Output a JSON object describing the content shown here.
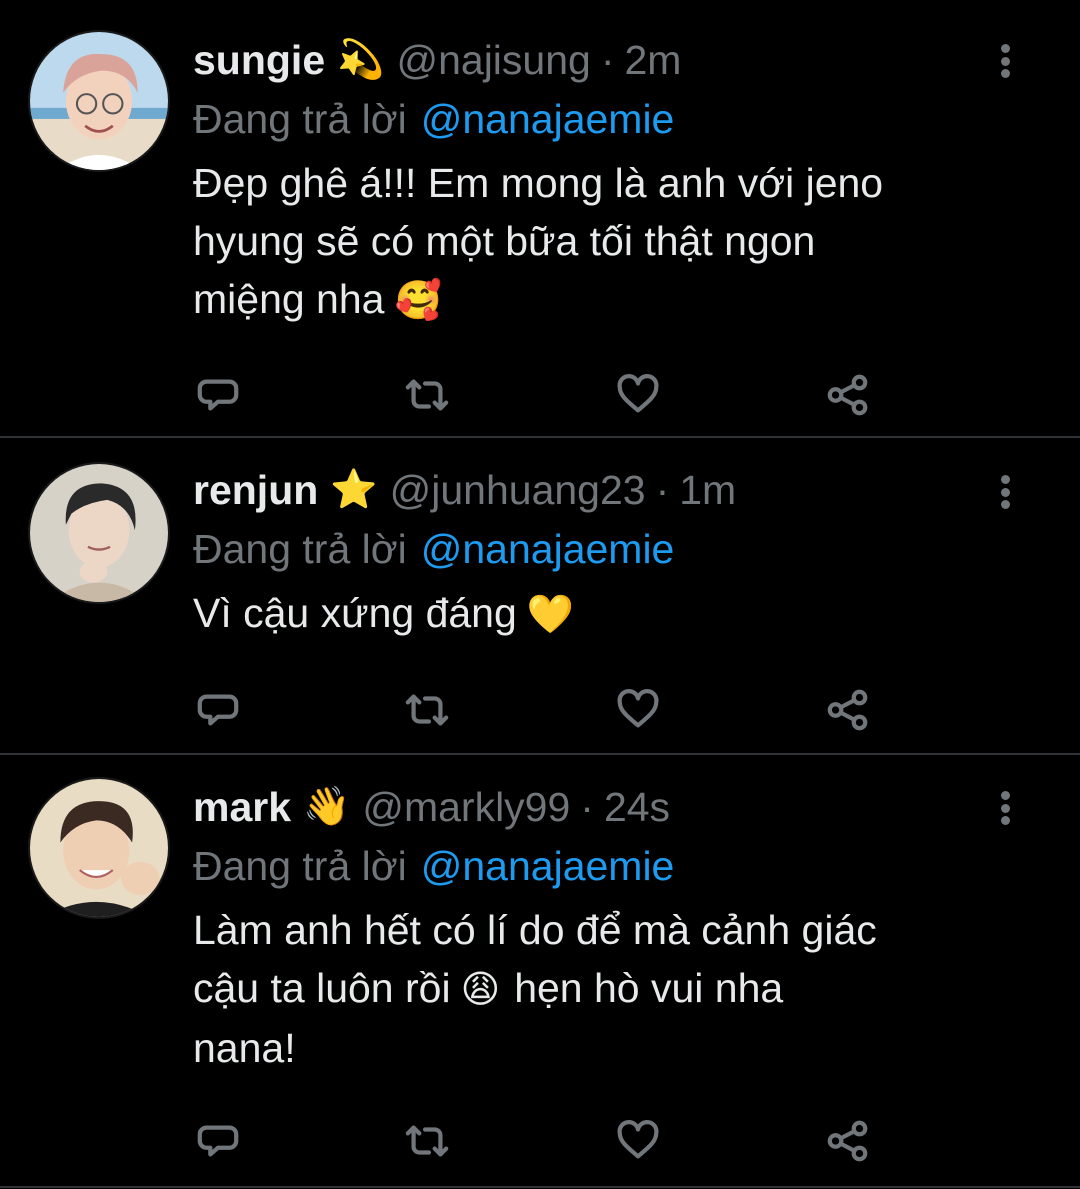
{
  "tweets": [
    {
      "display_name": "sungie",
      "badge_emoji": "💫",
      "handle": "@najisung",
      "separator": "·",
      "time": "2m",
      "reply_prefix": "Đang trả lời",
      "reply_to": "@nanajaemie",
      "body_lines": [
        "Đẹp ghê á!!! Em mong là anh với jeno",
        "hyung sẽ có một bữa tối thật ngon",
        "miệng nha"
      ],
      "body_emoji": "🥰",
      "avatar": "avatar-sungie",
      "icons": {
        "reply": "reply-icon",
        "retweet": "retweet-icon",
        "like": "heart-icon",
        "share": "share-icon",
        "more": "more-vertical-icon"
      }
    },
    {
      "display_name": "renjun",
      "badge_emoji": "⭐",
      "handle": "@junhuang23",
      "separator": "·",
      "time": "1m",
      "reply_prefix": "Đang trả lời",
      "reply_to": "@nanajaemie",
      "body_lines": [
        "Vì cậu xứng đáng"
      ],
      "body_emoji": "💛",
      "avatar": "avatar-renjun",
      "icons": {
        "reply": "reply-icon",
        "retweet": "retweet-icon",
        "like": "heart-icon",
        "share": "share-icon",
        "more": "more-vertical-icon"
      }
    },
    {
      "display_name": "mark",
      "badge_emoji": "👋",
      "handle": "@markly99",
      "separator": "·",
      "time": "24s",
      "reply_prefix": "Đang trả lời",
      "reply_to": "@nanajaemie",
      "body_lines": [
        "Làm anh hết có lí do để mà cảnh giác",
        "cậu ta luôn rồi",
        "hẹn hò vui nha",
        "nana!"
      ],
      "body_emoji": "😩",
      "avatar": "avatar-mark",
      "icons": {
        "reply": "reply-icon",
        "retweet": "retweet-icon",
        "like": "heart-icon",
        "share": "share-icon",
        "more": "more-vertical-icon"
      }
    }
  ],
  "colors": {
    "background": "#000000",
    "text_primary": "#e7e9ea",
    "text_secondary": "#71767b",
    "link": "#1d9bf0",
    "divider": "#2f3336"
  }
}
